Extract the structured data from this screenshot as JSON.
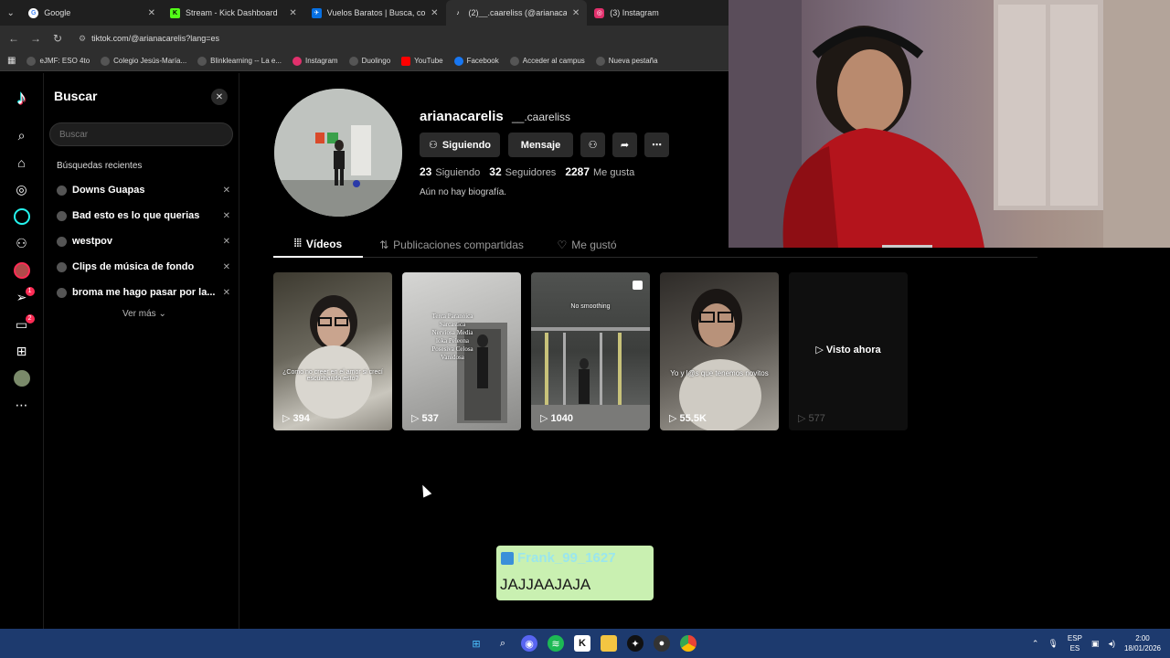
{
  "browser": {
    "tabs": [
      {
        "title": "Google",
        "icon": "google-icon",
        "color": "#ffffff"
      },
      {
        "title": "Stream - Kick Dashboard",
        "icon": "kick-icon",
        "color": "#53fc18"
      },
      {
        "title": "Vuelos Baratos | Busca, compar",
        "icon": "flights-icon",
        "color": "#0770e3"
      },
      {
        "title": "(2)__.caareliss (@arianacarelis) |",
        "icon": "tiktok-icon",
        "color": "#000000"
      },
      {
        "title": "(3) Instagram",
        "icon": "instagram-icon",
        "color": "#e1306c"
      }
    ],
    "url": "tiktok.com/@arianacarelis?lang=es",
    "bookmarks": [
      {
        "label": "eJMF: ESO 4to",
        "icon": "globe-icon"
      },
      {
        "label": "Colegio Jesús-María...",
        "icon": "globe-icon"
      },
      {
        "label": "Blinklearning -- La e...",
        "icon": "globe-icon"
      },
      {
        "label": "Instagram",
        "icon": "instagram-icon"
      },
      {
        "label": "Duolingo",
        "icon": "globe-icon"
      },
      {
        "label": "YouTube",
        "icon": "youtube-icon"
      },
      {
        "label": "Facebook",
        "icon": "facebook-icon"
      },
      {
        "label": "Acceder al campus",
        "icon": "globe-icon"
      },
      {
        "label": "Nueva pestaña",
        "icon": "globe-icon"
      }
    ]
  },
  "rail": {
    "badges": {
      "inbox": "1",
      "messages": "2"
    }
  },
  "search": {
    "title": "Buscar",
    "placeholder": "Buscar",
    "recent_label": "Búsquedas recientes",
    "recent": [
      "Downs Guapas",
      "Bad esto es lo que querias",
      "westpov",
      "Clips de música de fondo",
      "broma me hago pasar por la..."
    ],
    "more_label": "Ver más"
  },
  "profile": {
    "username": "arianacarelis",
    "nickname": "__.caareliss",
    "follow_label": "Siguiendo",
    "message_label": "Mensaje",
    "stats": {
      "following": "23",
      "following_label": "Siguiendo",
      "followers": "32",
      "followers_label": "Seguidores",
      "likes": "2287",
      "likes_label": "Me gusta"
    },
    "bio": "Aún no hay biografía.",
    "tabs": [
      "Vídeos",
      "Publicaciones compartidas",
      "Me gustó"
    ]
  },
  "videos": [
    {
      "views": "394",
      "caption": "¿Como no creer en el amor si crecí escuchando esto?"
    },
    {
      "views": "537",
      "caption": "Terca Paranoica Sarcastica Nerviosa Media loka Peleona Posesiva Celosa Vanidosa"
    },
    {
      "views": "1040",
      "caption": "No smoothing"
    },
    {
      "views": "55.5K",
      "caption": "Yo y l@s que tenemos novitos"
    },
    {
      "views": "577",
      "overlay": "Visto ahora"
    }
  ],
  "chat": {
    "user": "Frank_99_1627",
    "message": "JAJJAAJAJA"
  },
  "taskbar": {
    "lang_top": "ESP",
    "lang_bottom": "ES",
    "time": "2:00",
    "date": "18/01/2026"
  }
}
